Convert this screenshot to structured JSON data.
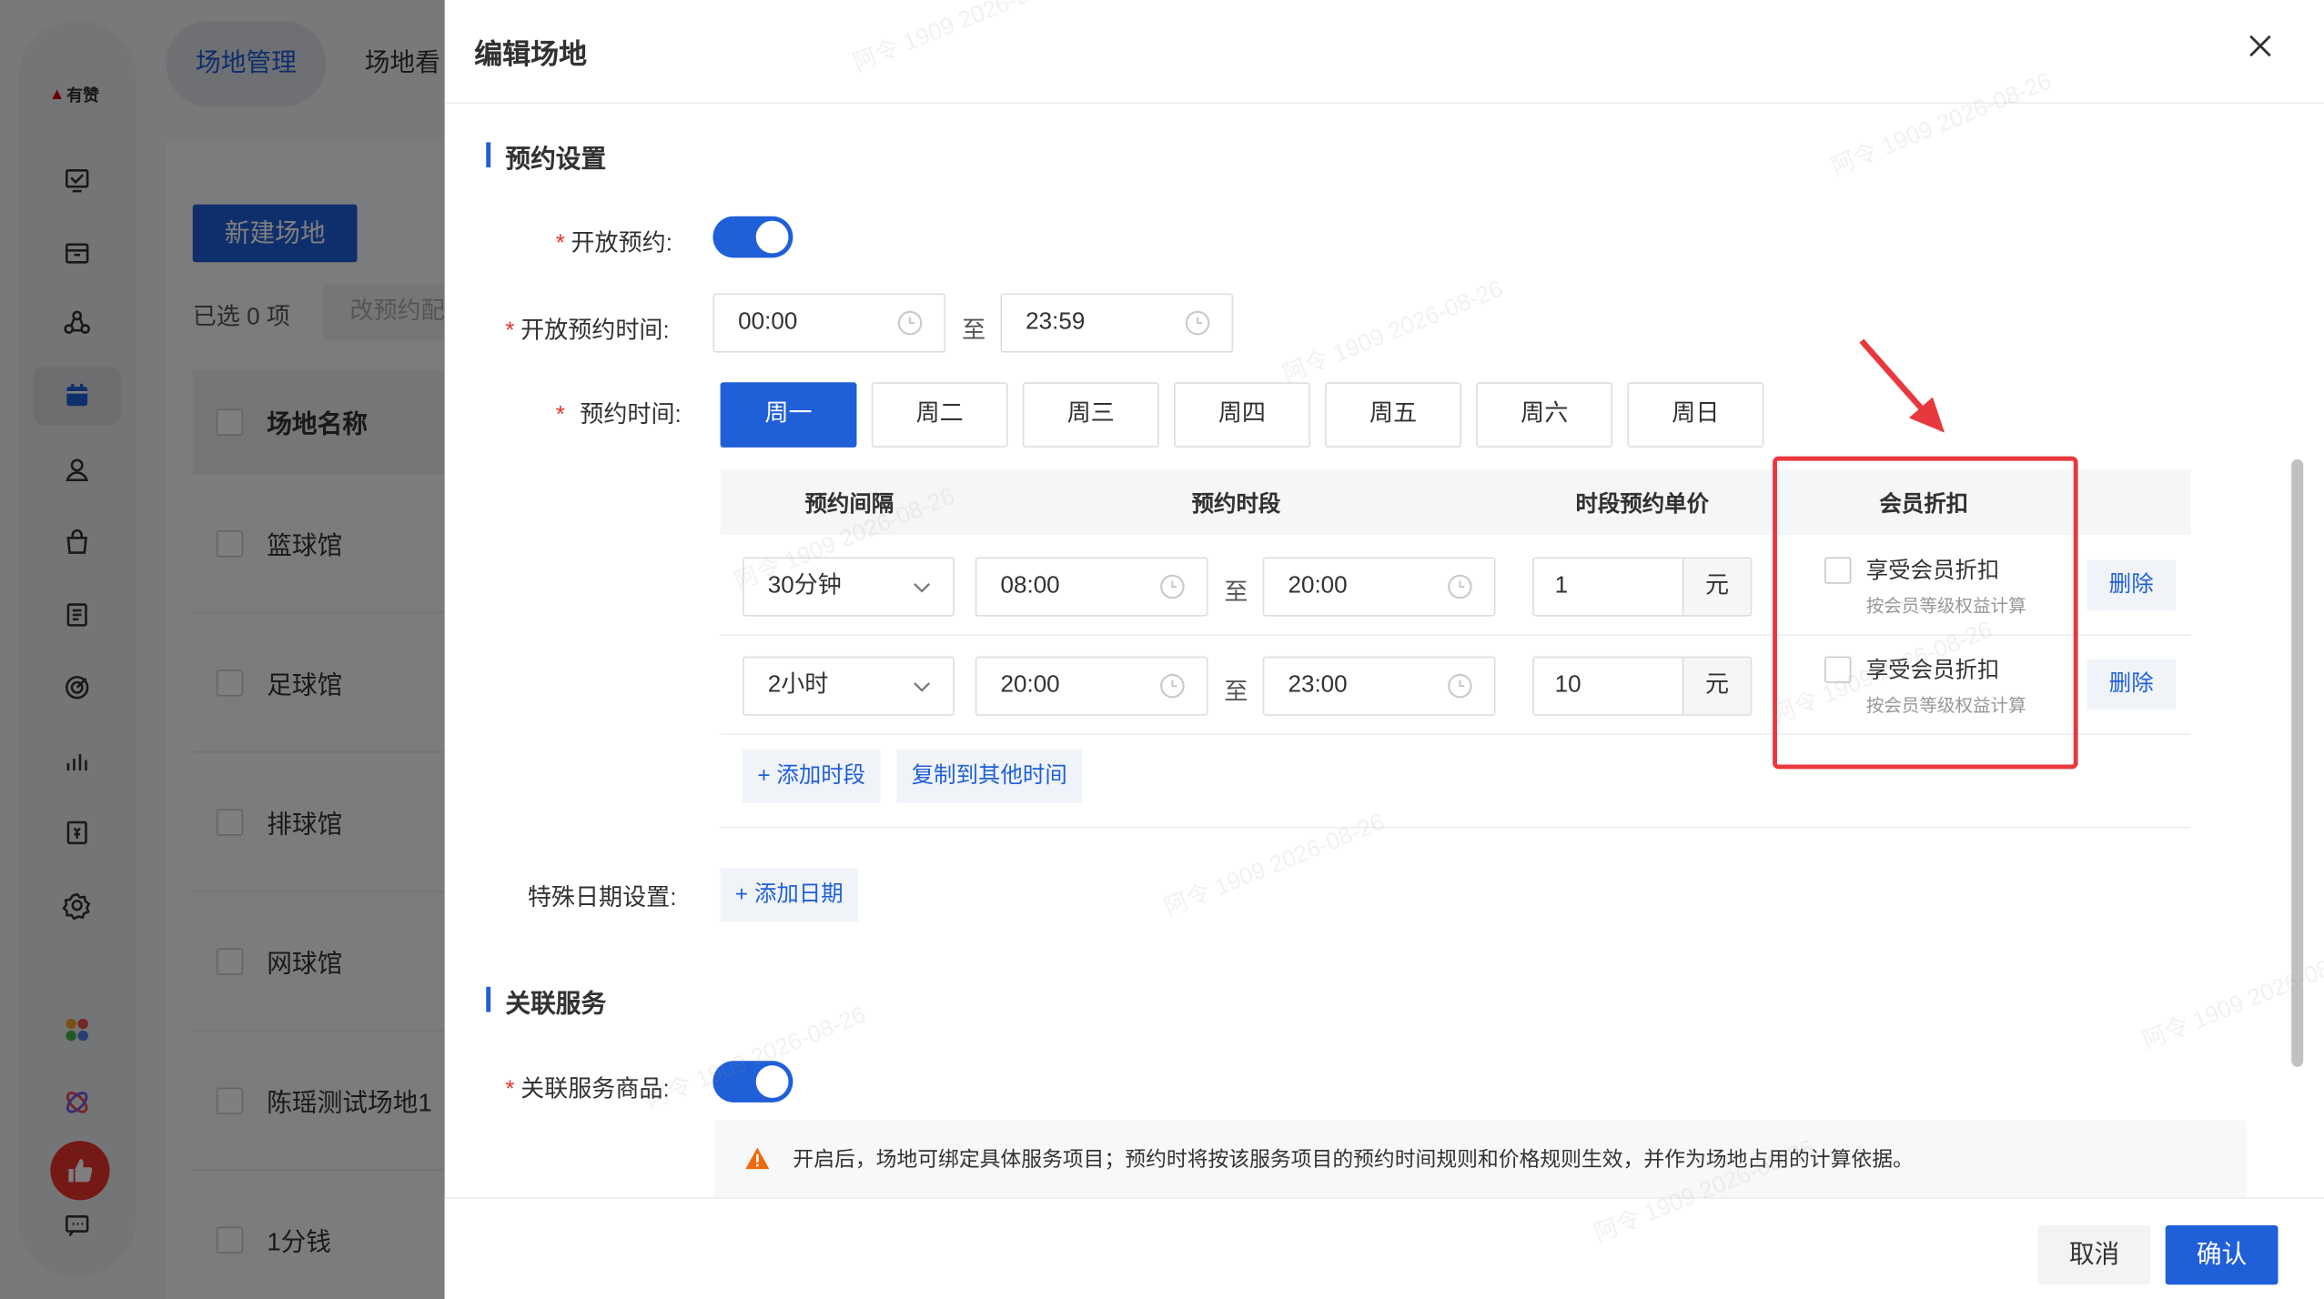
{
  "app": {
    "logo_text": "有赞"
  },
  "topbar": {
    "tabs": [
      {
        "label": "场地管理"
      },
      {
        "label": "场地看"
      }
    ]
  },
  "list": {
    "new_button": "新建场地",
    "selected_text": "已选 0 项",
    "batch_button": "改预约配",
    "header": "场地名称",
    "rows": [
      "篮球馆",
      "足球馆",
      "排球馆",
      "网球馆",
      "陈瑶测试场地1",
      "1分钱"
    ]
  },
  "drawer": {
    "title": "编辑场地",
    "section_booking": "预约设置",
    "open_booking_label": "开放预约:",
    "open_time_label": "开放预约时间:",
    "open_time_start": "00:00",
    "open_time_end": "23:59",
    "range_sep": "至",
    "booking_time_label": "预约时间:",
    "days": [
      "周一",
      "周二",
      "周三",
      "周四",
      "周五",
      "周六",
      "周日"
    ],
    "table_headers": {
      "interval": "预约间隔",
      "period": "预约时段",
      "price": "时段预约单价",
      "member": "会员折扣"
    },
    "slots": [
      {
        "interval": "30分钟",
        "start": "08:00",
        "end": "20:00",
        "price": "1",
        "unit": "元",
        "member_label": "享受会员折扣",
        "member_sub": "按会员等级权益计算",
        "delete": "删除"
      },
      {
        "interval": "2小时",
        "start": "20:00",
        "end": "23:00",
        "price": "10",
        "unit": "元",
        "member_label": "享受会员折扣",
        "member_sub": "按会员等级权益计算",
        "delete": "删除"
      }
    ],
    "add_slot": "+ 添加时段",
    "copy_other": "复制到其他时间",
    "special_date_label": "特殊日期设置:",
    "add_date": "+ 添加日期",
    "section_service": "关联服务",
    "service_label": "关联服务商品:",
    "notice": "开启后，场地可绑定具体服务项目；预约时将按该服务项目的预约时间规则和价格规则生效，并作为场地占用的计算依据。",
    "cancel": "取消",
    "confirm": "确认"
  },
  "watermark": "阿令 1909 2026-08-26",
  "colors": {
    "primary": "#1f5fd8",
    "highlight": "#e8383d",
    "danger": "#e8332d"
  }
}
